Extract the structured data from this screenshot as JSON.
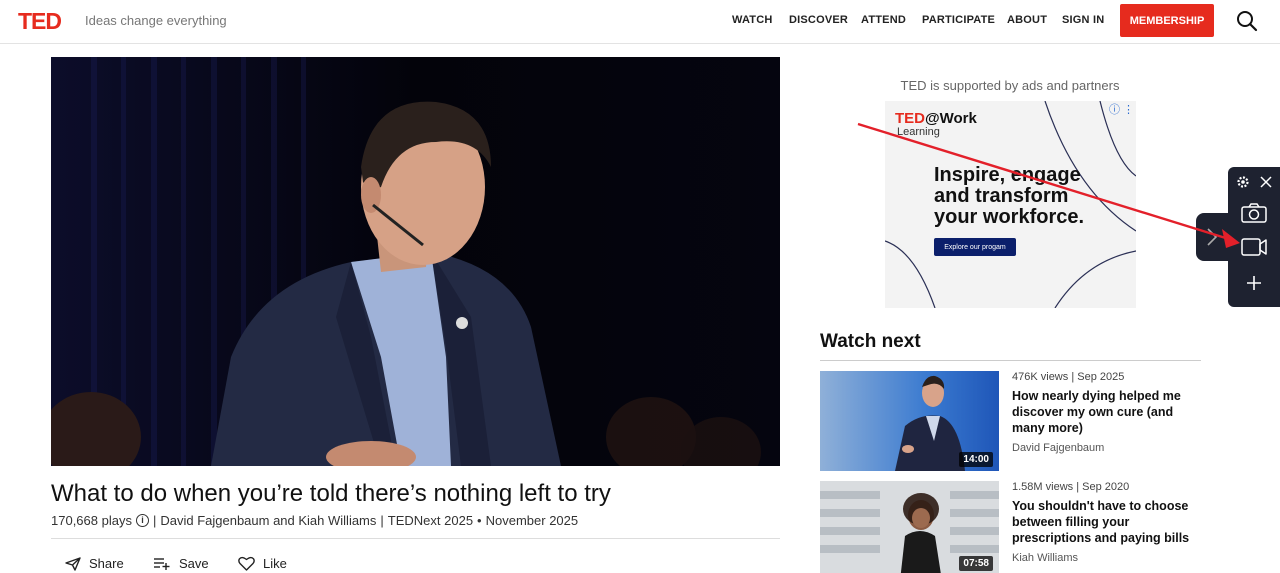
{
  "header": {
    "logo": "TED",
    "tagline": "Ideas change everything",
    "nav": [
      "WATCH",
      "DISCOVER",
      "ATTEND",
      "PARTICIPATE",
      "ABOUT",
      "SIGN IN"
    ],
    "membership_label": "MEMBERSHIP",
    "search_icon": "search-icon",
    "brand_color": "#e62b1e"
  },
  "video": {
    "title": "What to do when you’re told there’s nothing left to try",
    "plays": "170,668 plays",
    "speakers": "David Fajgenbaum and Kiah Williams",
    "event": "TEDNext 2025",
    "date": "November 2025",
    "info_icon": "info-icon"
  },
  "actions": {
    "share": "Share",
    "save": "Save",
    "like": "Like"
  },
  "ad": {
    "note": "TED is supported by ads and partners",
    "brand_ted": "TED",
    "brand_rest": "@Work",
    "brand_sub": "Learning",
    "headline_1": "Inspire, engage",
    "headline_2": "and transform",
    "headline_3": "your workforce.",
    "button": "Explore our progam"
  },
  "watch_next": {
    "heading": "Watch next",
    "items": [
      {
        "views": "476K views",
        "date": "Sep 2025",
        "title": "How nearly dying helped me discover my own cure (and many more)",
        "speaker": "David Fajgenbaum",
        "duration": "14:00"
      },
      {
        "views": "1.58M views",
        "date": "Sep 2020",
        "title": "You shouldn't have to choose between filling your prescriptions and paying bills",
        "speaker": "Kiah Williams",
        "duration": "07:58"
      }
    ]
  },
  "tool_panel": {
    "icons": [
      "gear-icon",
      "close-icon",
      "camera-icon",
      "video-record-icon",
      "plus-icon",
      "chevron-right-icon"
    ],
    "panel_color": "#1e2230"
  }
}
